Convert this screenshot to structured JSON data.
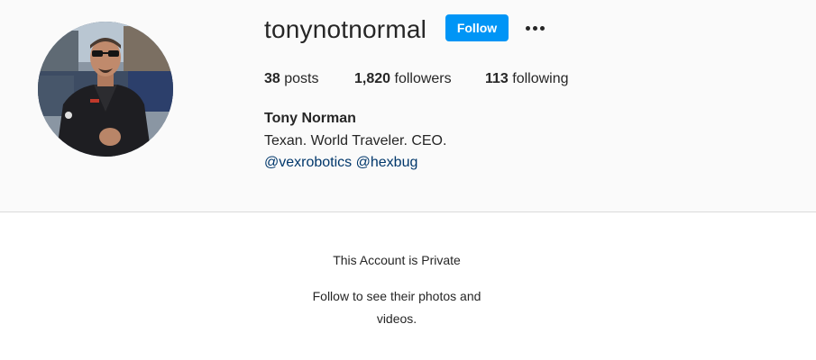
{
  "profile": {
    "username": "tonynotnormal",
    "follow_label": "Follow",
    "options_icon": "more-options-icon",
    "avatar_icon": "profile-photo",
    "stats": {
      "posts_count": "38",
      "posts_label": "posts",
      "followers_count": "1,820",
      "followers_label": "followers",
      "following_count": "113",
      "following_label": "following"
    },
    "full_name": "Tony Norman",
    "bio": "Texan. World Traveler. CEO.",
    "links": [
      "@vexrobotics",
      "@hexbug"
    ]
  },
  "private_notice": {
    "title": "This Account is Private",
    "subtitle": "Follow to see their photos and videos."
  },
  "colors": {
    "accent": "#0095f6",
    "link": "#00376b",
    "text": "#262626",
    "header_bg": "#fafafa",
    "divider": "#dbdbdb"
  }
}
